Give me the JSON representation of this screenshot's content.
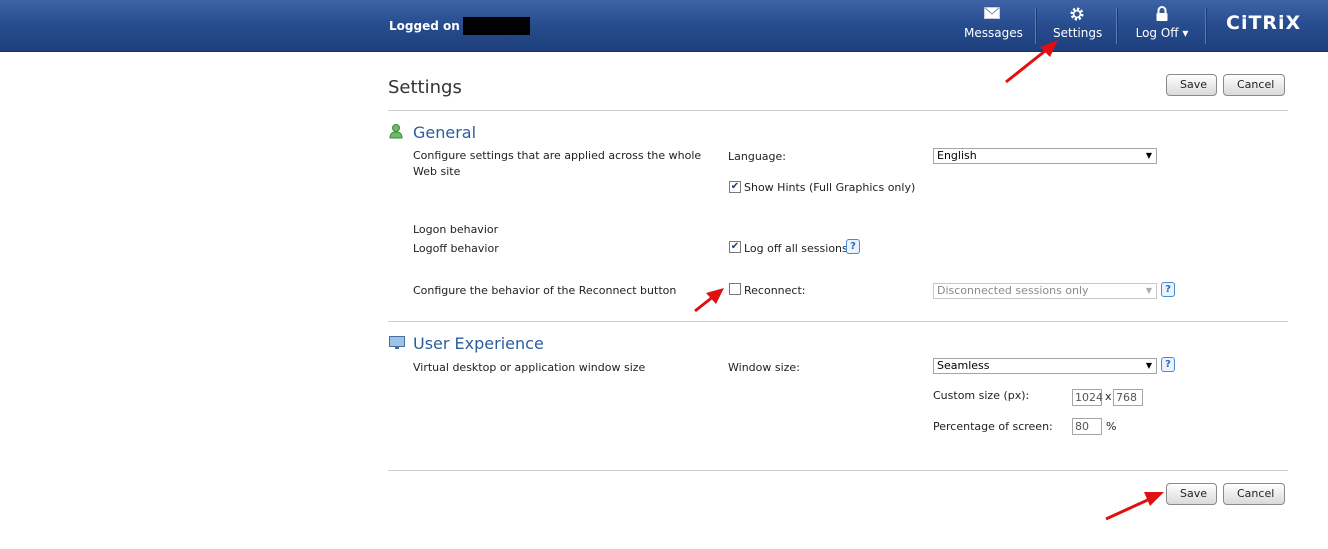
{
  "header": {
    "logged_on_label": "Logged on as:",
    "nav": {
      "messages_label": "Messages",
      "settings_label": "Settings",
      "logoff_label": "Log Off ▾"
    },
    "logo_text": "CiTRiX"
  },
  "page": {
    "title": "Settings",
    "save_label": "Save",
    "cancel_label": "Cancel"
  },
  "general": {
    "title": "General",
    "description": "Configure settings that are applied across the whole Web site",
    "language_label": "Language:",
    "language_value": "English",
    "show_hints_label": "Show Hints (Full Graphics only)",
    "show_hints_checked": true,
    "logon_behavior_label": "Logon behavior",
    "logoff_behavior_label": "Logoff behavior",
    "logoff_all_label": "Log off all sessions",
    "logoff_all_checked": true,
    "reconnect_desc": "Configure the behavior of the Reconnect button",
    "reconnect_label": "Reconnect:",
    "reconnect_checked": false,
    "reconnect_value": "Disconnected sessions only"
  },
  "user_experience": {
    "title": "User Experience",
    "description": "Virtual desktop or application window size",
    "window_size_label": "Window size:",
    "window_size_value": "Seamless",
    "custom_size_label": "Custom size (px):",
    "width_value": "1024",
    "x_separator": "x",
    "height_value": "768",
    "percentage_label": "Percentage of screen:",
    "percentage_value": "80",
    "percent_symbol": "%"
  },
  "colors": {
    "header_bg": "#274c8e",
    "section_title": "#2a5d9f",
    "annotation_arrow": "#e01010"
  },
  "icons": [
    "envelope-icon",
    "gear-icon",
    "lock-icon",
    "user-icon",
    "monitor-icon",
    "help-icon",
    "checkbox-check-icon",
    "dropdown-arrow-icon",
    "red-arrow-annotation"
  ]
}
